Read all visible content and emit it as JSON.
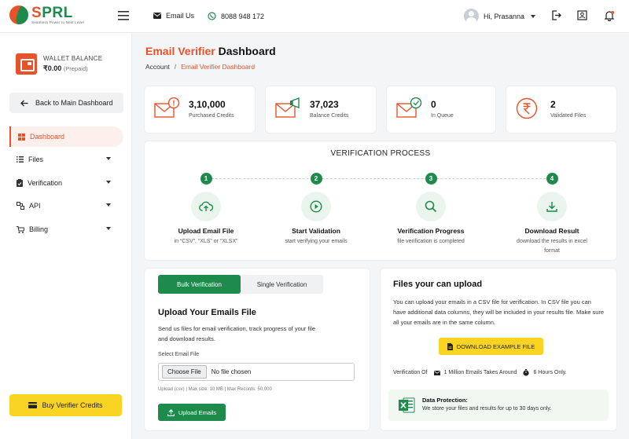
{
  "header": {
    "logo": {
      "name_left": "S",
      "name_right": "PRL",
      "tagline": "Seamless Power to Next Level"
    },
    "email_label": "Email Us",
    "phone_label": "8088 948 172",
    "user_greeting": "Hi, Prasanna"
  },
  "sidebar": {
    "wallet": {
      "label": "WALLET BALANCE",
      "amount": "₹0.00",
      "type": "(Prepaid)"
    },
    "back_label": "Back to Main Dashboard",
    "items": [
      {
        "label": "Dashboard",
        "icon": "grid-icon",
        "active": true
      },
      {
        "label": "Files",
        "icon": "list-icon"
      },
      {
        "label": "Verification",
        "icon": "clipboard-icon"
      },
      {
        "label": "API",
        "icon": "api-icon"
      },
      {
        "label": "Billing",
        "icon": "cart-icon"
      }
    ],
    "buy_label": "Buy Verifier Credits"
  },
  "page": {
    "title_accent": "Email Verifier",
    "title_rest": " Dashboard",
    "breadcrumb": {
      "root": "Account",
      "sep": "/",
      "current": "Email Verifier Dashboard"
    }
  },
  "stats": [
    {
      "value": "3,10,000",
      "label": "Purchased Credits",
      "icon": "mail-alert-icon"
    },
    {
      "value": "37,023",
      "label": "Balance Credits",
      "icon": "mail-megaphone-icon"
    },
    {
      "value": "0",
      "label": "In Queue",
      "icon": "mail-check-icon"
    },
    {
      "value": "2",
      "label": "Validated Files",
      "icon": "rupee-icon"
    }
  ],
  "process": {
    "title": "VERIFICATION PROCESS",
    "steps": [
      {
        "num": "1",
        "title": "Upload Email File",
        "sub": "in “CSV”, “XLS” or “XLSX”",
        "icon": "cloud-upload-icon"
      },
      {
        "num": "2",
        "title": "Start Validation",
        "sub": "start verifying your emails",
        "icon": "play-icon"
      },
      {
        "num": "3",
        "title": "Verification Progress",
        "sub": "file verification is completed",
        "icon": "magnifier-icon"
      },
      {
        "num": "4",
        "title": "Download Result",
        "sub": "download the results in excel format",
        "icon": "download-icon"
      }
    ]
  },
  "upload": {
    "tabs": [
      {
        "label": "Bulk Verification"
      },
      {
        "label": "Single Verification"
      }
    ],
    "title": "Upload Your Emails File",
    "desc": "Send us files for email verification, track progress of your file and download results.",
    "select_label": "Select Email File",
    "choose_label": "Choose File",
    "no_file": "No file chosen",
    "hint": "Upload (csv) | Max size: 10 MB | Max Records: 50,000",
    "button": "Upload Emails"
  },
  "info": {
    "title": "Files your can upload",
    "desc": "You can upload your emails in a CSV file for verification. In CSV file you can have additional data columns, they will be included in your results file. Make sure all your emails are in the same column.",
    "download_button": "DOWNLOAD EXAMPLE FILE",
    "verify_of": "Verification Of",
    "takes": "1 Million Emails Takes Around",
    "duration": "6 Hours Only.",
    "protection_title": "Data Protection:",
    "protection_text": "We store your files and results for up to 30 days only."
  },
  "colors": {
    "brand_green": "#1e8a4c",
    "brand_orange": "#e8522b",
    "accent_yellow": "#f9d423"
  }
}
